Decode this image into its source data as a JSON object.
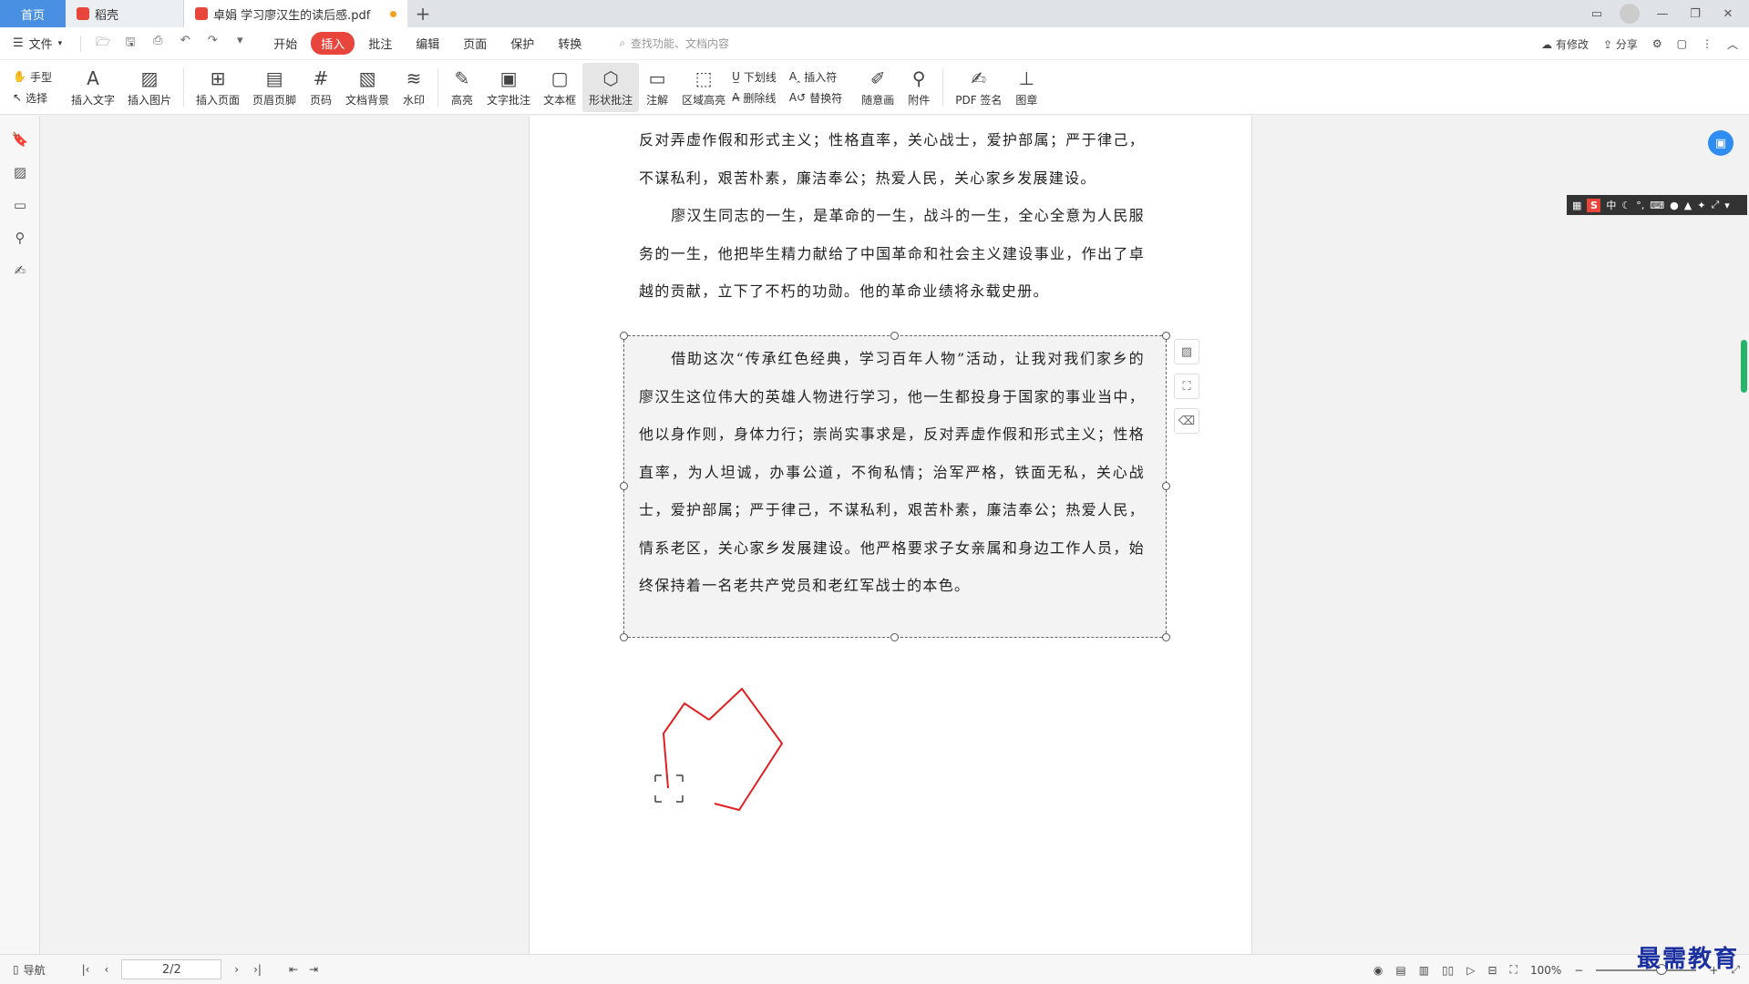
{
  "titlebar": {
    "tabs": [
      {
        "label": "首页"
      },
      {
        "label": "稻壳"
      },
      {
        "label": "卓娟 学习廖汉生的读后感.pdf"
      }
    ]
  },
  "menubar": {
    "file_label": "文件",
    "tabs": [
      "开始",
      "插入",
      "批注",
      "编辑",
      "页面",
      "保护",
      "转换"
    ],
    "active_tab": "插入",
    "search_placeholder": "查找功能、文档内容",
    "right": {
      "modify": "有修改",
      "share": "分享"
    }
  },
  "ribbon": {
    "hand": "手型",
    "select": "选择",
    "buttons": [
      "插入文字",
      "插入图片",
      "插入页面",
      "页眉页脚",
      "页码",
      "文档背景",
      "水印",
      "高亮",
      "文字批注",
      "文本框",
      "形状批注",
      "注解",
      "区域高亮"
    ],
    "underline": "下划线",
    "strike": "删除线",
    "insert_char": "插入符",
    "replace_char": "替换符",
    "freehand": "随意画",
    "attach": "附件",
    "pdf_sign": "PDF 签名",
    "stamp": "图章"
  },
  "document": {
    "para1": "反对弄虚作假和形式主义；性格直率，关心战士，爱护部属；严于律己，不谋私利，艰苦朴素，廉洁奉公；热爱人民，关心家乡发展建设。",
    "para2": "廖汉生同志的一生，是革命的一生，战斗的一生，全心全意为人民服务的一生，他把毕生精力献给了中国革命和社会主义建设事业，作出了卓越的贡献，立下了不朽的功勋。他的革命业绩将永载史册。",
    "para3": "借助这次“传承红色经典，学习百年人物”活动，让我对我们家乡的廖汉生这位伟大的英雄人物进行学习，他一生都投身于国家的事业当中，他以身作则，身体力行；崇尚实事求是，反对弄虚作假和形式主义；性格直率，为人坦诚，办事公道，不徇私情；治军严格，铁面无私，关心战士，爱护部属；严于律己，不谋私利，艰苦朴素，廉洁奉公；热爱人民，情系老区，关心家乡发展建设。他严格要求子女亲属和身边工作人员，始终保持着一名老共产党员和老红军战士的本色。"
  },
  "ime": {
    "lang": "中"
  },
  "statusbar": {
    "nav": "导航",
    "page": "2/2",
    "zoom": "100%"
  },
  "watermark": "最需教育",
  "colors": {
    "accent": "#e8453c",
    "home_tab": "#4a90e2",
    "shape_stroke": "#e02020"
  }
}
